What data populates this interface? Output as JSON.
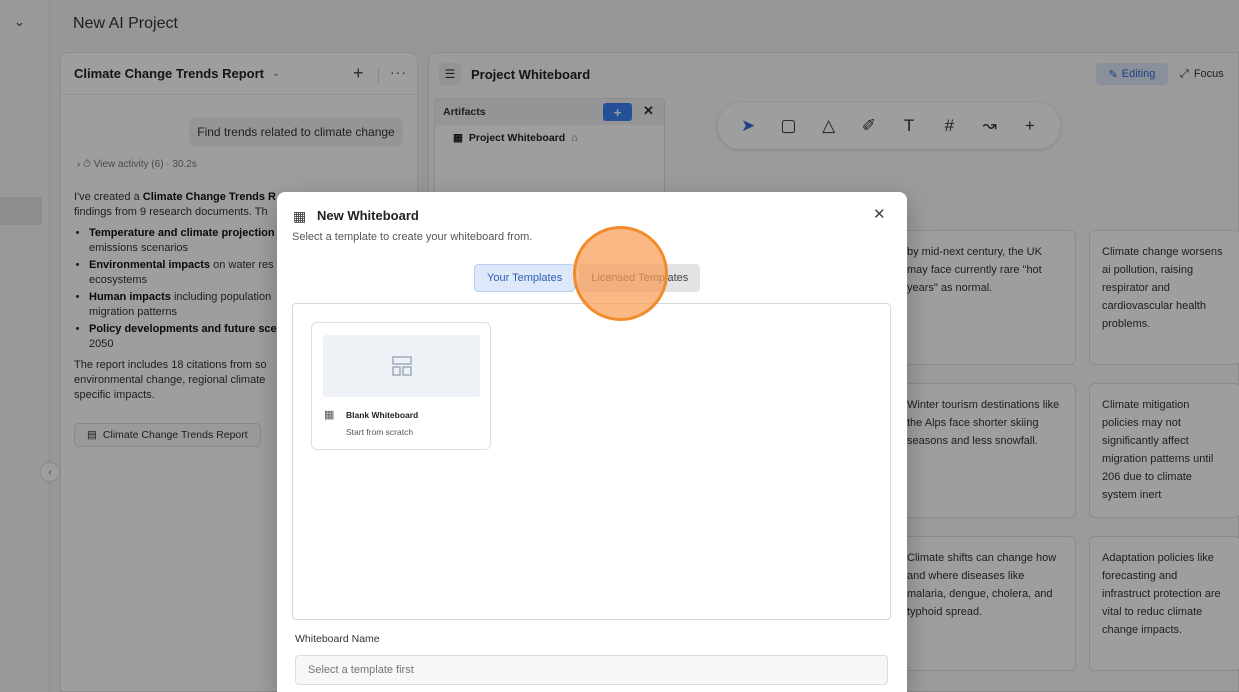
{
  "project": {
    "title": "New AI Project"
  },
  "chat": {
    "title": "Climate Change Trends Report",
    "user_message": "Find trends related to climate change",
    "activity": "View activity (6) · 30.2s",
    "intro_prefix": "I've created a ",
    "intro_bold": "Climate Change Trends R",
    "intro_line2": "findings from 9 research documents. Th",
    "bullets": [
      {
        "bold": "Temperature and climate projection",
        "rest": "",
        "line2": "emissions scenarios"
      },
      {
        "bold": "Environmental impacts",
        "rest": " on water res",
        "line2": "ecosystems"
      },
      {
        "bold": "Human impacts",
        "rest": " including population",
        "line2": "migration patterns"
      },
      {
        "bold": "Policy developments and future sce",
        "rest": "",
        "line2": "2050"
      }
    ],
    "closing_l1": "The report includes 18 citations from so",
    "closing_l2": "environmental change, regional climate",
    "closing_l3": "specific impacts.",
    "report_chip": "Climate Change Trends Report"
  },
  "whiteboard": {
    "title": "Project Whiteboard",
    "editing_label": "Editing",
    "focus_label": "Focus",
    "artifacts_title": "Artifacts",
    "artifact_item": "Project Whiteboard",
    "notes": [
      "by mid-next century, the UK may face currently rare \"hot years\" as normal.",
      "Climate change worsens ai pollution, raising respirator and cardiovascular health problems.",
      "Winter tourism destinations like the Alps face shorter skiing seasons and less snowfall.",
      "Climate mitigation policies may not significantly affect migration patterns until 206 due to climate system inert",
      "Climate shifts can change how and where diseases like malaria, dengue, cholera, and typhoid spread.",
      "Adaptation policies like forecasting and infrastruct protection are vital to reduc climate change impacts."
    ]
  },
  "modal": {
    "title": "New Whiteboard",
    "subtitle": "Select a template to create your whiteboard from.",
    "tab_your": "Your Templates",
    "tab_licensed": "Licensed Templates",
    "card_name": "Blank Whiteboard",
    "card_desc": "Start from scratch",
    "name_label": "Whiteboard Name",
    "name_placeholder": "Select a template first"
  },
  "icons": [
    "chevron-down-icon",
    "plus-icon",
    "more-icon",
    "menu-icon",
    "pencil-icon",
    "focus-icon",
    "home-icon",
    "select-icon",
    "note-icon",
    "shapes-icon",
    "pen-icon",
    "text-icon",
    "frame-icon",
    "connector-icon",
    "close-icon",
    "template-icon"
  ],
  "colors": {
    "accent": "#3b82f6",
    "click_indicator": "#f28b2a"
  }
}
